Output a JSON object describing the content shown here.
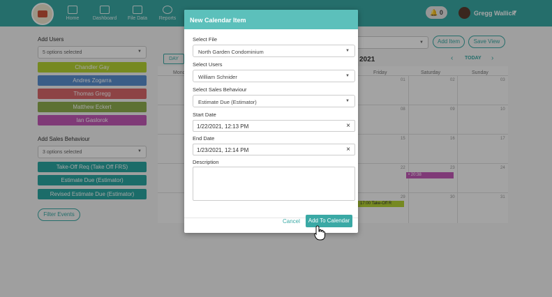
{
  "nav": {
    "items": [
      {
        "label": "Home",
        "icon": "bar-chart-icon"
      },
      {
        "label": "Dashboard",
        "icon": "dashboard-icon"
      },
      {
        "label": "File Data",
        "icon": "folder-icon"
      },
      {
        "label": "Reports",
        "icon": "target-icon"
      }
    ],
    "notification_count": "0",
    "user_name": "Gregg Wallick",
    "colors": {
      "primary": "#3aa9a5",
      "header": "#5cc0bb"
    }
  },
  "sidebar": {
    "add_users_label": "Add Users",
    "users_select_value": "5 options selected",
    "users": [
      {
        "name": "Chandler Gay",
        "color": "#b5d334"
      },
      {
        "name": "Andres Zogarra",
        "color": "#5a8fd0"
      },
      {
        "name": "Thomas Gregg",
        "color": "#d9676b"
      },
      {
        "name": "Matthew Eckert",
        "color": "#8fae4f"
      },
      {
        "name": "Ian Gaslorok",
        "color": "#c45ab7"
      }
    ],
    "sales_behaviour_label": "Add Sales Behaviour",
    "behaviour_select_value": "3 options selected",
    "behaviours": [
      {
        "name": "Take-Off Req (Take Off FRS)",
        "color": "#2aa7a1"
      },
      {
        "name": "Estimate Due (Estimator)",
        "color": "#2aa7a1"
      },
      {
        "name": "Revised Estimate Due (Estimator)",
        "color": "#2aa7a1"
      }
    ],
    "filter_button": "Filter Events"
  },
  "calendar": {
    "day_button": "DAY",
    "month_title": "2021",
    "today_label": "TODAY",
    "add_item_button": "Add Item",
    "save_view_button": "Save View",
    "headers": [
      "Monday",
      "Friday",
      "Saturday",
      "Sunday"
    ],
    "day_numbers": [
      "01",
      "02",
      "03",
      "08",
      "09",
      "10",
      "15",
      "16",
      "17",
      "22",
      "23",
      "24",
      "29",
      "30",
      "31"
    ],
    "events": [
      {
        "label": "• 20:38",
        "color": "#c45ab7"
      },
      {
        "label": "17:00 Take-Off R",
        "color": "#b5d334"
      }
    ]
  },
  "modal": {
    "title": "New Calendar Item",
    "select_file_label": "Select File",
    "select_file_value": "North Garden Condominium",
    "select_users_label": "Select Users",
    "select_users_value": "William Schnider",
    "sales_behaviour_label": "Select Sales Behaviour",
    "sales_behaviour_value": "Estimate Due (Estimator)",
    "start_date_label": "Start Date",
    "start_date_value": "1/22/2021, 12:13 PM",
    "end_date_label": "End Date",
    "end_date_value": "1/23/2021, 12:14 PM",
    "description_label": "Description",
    "description_value": "",
    "cancel_button": "Cancel",
    "add_button": "Add To Calendar"
  }
}
